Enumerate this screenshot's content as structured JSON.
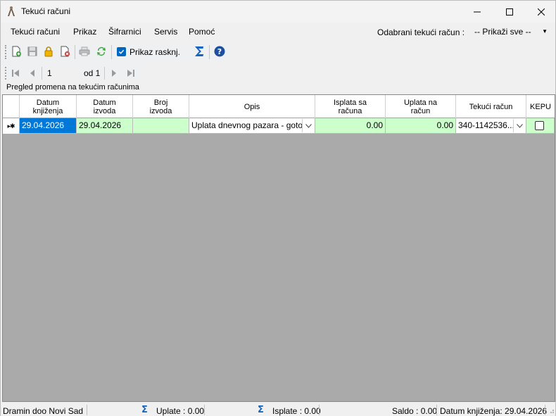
{
  "window": {
    "title": "Tekući računi"
  },
  "menu": {
    "items": [
      "Tekući računi",
      "Prikaz",
      "Šifrarnici",
      "Servis",
      "Pomoć"
    ],
    "account_label": "Odabrani tekući račun :",
    "account_value": "-- Prikaži sve --"
  },
  "toolbar": {
    "show_closing_label": "Prikaz rasknj.",
    "show_closing_checked": true
  },
  "navigator": {
    "position": "1",
    "of_label": "od 1"
  },
  "group_label": "Pregled promena na tekućim računima",
  "grid": {
    "columns": [
      "Datum\nknjiženja",
      "Datum\nizvoda",
      "Broj\nizvoda",
      "Opis",
      "Isplata sa\nračuna",
      "Uplata na\nračun",
      "Tekući račun",
      "KEPU"
    ],
    "row_indicator": "▸✱",
    "rows": [
      {
        "datum_knjizenja": "29.04.2026",
        "datum_izvoda": "29.04.2026",
        "broj_izvoda": "",
        "opis": "Uplata dnevnog pazara - goto...",
        "isplata": "0.00",
        "uplata": "0.00",
        "tekuci_racun": "340-1142536...",
        "kepu": false
      }
    ]
  },
  "status": {
    "company": "Dramin doo Novi Sad",
    "uplate": "Uplate : 0.00",
    "isplate": "Isplate : 0.00",
    "saldo": "Saldo : 0.00",
    "datum": "Datum knjiženja: 29.04.2026"
  },
  "colors": {
    "accent": "#0078d7",
    "row_green": "#ccffcc",
    "grid_bg": "#aaaaaa"
  }
}
